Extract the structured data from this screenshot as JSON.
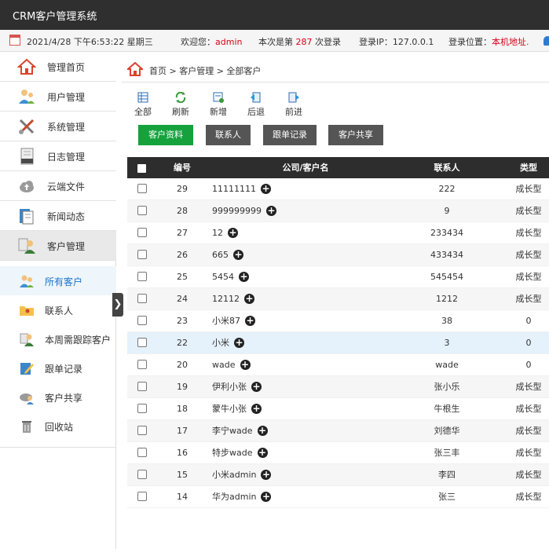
{
  "app": {
    "title": "CRM客户管理系统"
  },
  "infobar": {
    "datetime": "2021/4/28 下午6:53:22 星期三",
    "welcome_prefix": "欢迎您：",
    "username": "admin",
    "login_prefix": "本次是第",
    "login_count": "287",
    "login_suffix": "次登录",
    "ip_label": "登录IP：127.0.0.1",
    "location_label": "登录位置：",
    "location_value": "本机地址."
  },
  "sidebar": {
    "items": [
      {
        "label": "管理首页",
        "icon": "home-icon"
      },
      {
        "label": "用户管理",
        "icon": "users-icon"
      },
      {
        "label": "系统管理",
        "icon": "tools-icon"
      },
      {
        "label": "日志管理",
        "icon": "log-icon"
      },
      {
        "label": "云端文件",
        "icon": "cloud-icon"
      },
      {
        "label": "新闻动态",
        "icon": "news-icon"
      },
      {
        "label": "客户管理",
        "icon": "customer-icon"
      }
    ],
    "sub_items": [
      {
        "label": "所有客户",
        "icon": "all-customers-icon"
      },
      {
        "label": "联系人",
        "icon": "contacts-icon"
      },
      {
        "label": "本周需跟踪客户",
        "icon": "weekly-follow-icon"
      },
      {
        "label": "跟单记录",
        "icon": "follow-record-icon"
      },
      {
        "label": "客户共享",
        "icon": "share-icon"
      },
      {
        "label": "回收站",
        "icon": "recycle-bin-icon"
      }
    ],
    "toggle_glyph": "❯"
  },
  "breadcrumb": {
    "text": "首页 > 客户管理 > 全部客户"
  },
  "toolbar": {
    "buttons": [
      {
        "label": "全部",
        "icon": "grid-icon"
      },
      {
        "label": "刷新",
        "icon": "refresh-icon"
      },
      {
        "label": "新增",
        "icon": "add-icon"
      },
      {
        "label": "后退",
        "icon": "back-icon"
      },
      {
        "label": "前进",
        "icon": "forward-icon"
      }
    ]
  },
  "tabs": [
    "客户资料",
    "联系人",
    "跟单记录",
    "客户共享"
  ],
  "table": {
    "headers": {
      "no": "编号",
      "company": "公司/客户名",
      "contact": "联系人",
      "type": "类型"
    },
    "rows": [
      {
        "no": "29",
        "company": "11111111",
        "contact": "222",
        "type": "成长型"
      },
      {
        "no": "28",
        "company": "999999999",
        "contact": "9",
        "type": "成长型"
      },
      {
        "no": "27",
        "company": "12",
        "contact": "233434",
        "type": "成长型"
      },
      {
        "no": "26",
        "company": "665",
        "contact": "433434",
        "type": "成长型"
      },
      {
        "no": "25",
        "company": "5454",
        "contact": "545454",
        "type": "成长型"
      },
      {
        "no": "24",
        "company": "12112",
        "contact": "1212",
        "type": "成长型"
      },
      {
        "no": "23",
        "company": "小米87",
        "contact": "38",
        "type": "0"
      },
      {
        "no": "22",
        "company": "小米",
        "contact": "3",
        "type": "0"
      },
      {
        "no": "20",
        "company": "wade",
        "contact": "wade",
        "type": "0"
      },
      {
        "no": "19",
        "company": "伊利小张",
        "contact": "张小乐",
        "type": "成长型"
      },
      {
        "no": "18",
        "company": "蒙牛小张",
        "contact": "牛根生",
        "type": "成长型"
      },
      {
        "no": "17",
        "company": "李宁wade",
        "contact": "刘德华",
        "type": "成长型"
      },
      {
        "no": "16",
        "company": "特步wade",
        "contact": "张三丰",
        "type": "成长型"
      },
      {
        "no": "15",
        "company": "小米admin",
        "contact": "李四",
        "type": "成长型"
      },
      {
        "no": "14",
        "company": "华为admin",
        "contact": "张三",
        "type": "成长型"
      }
    ]
  },
  "colors": {
    "topbar": "#2f2f2f",
    "accent_green": "#15a23c",
    "tab_gray": "#555555",
    "active_blue": "#1b73c9",
    "highlight": "#d9001b"
  }
}
